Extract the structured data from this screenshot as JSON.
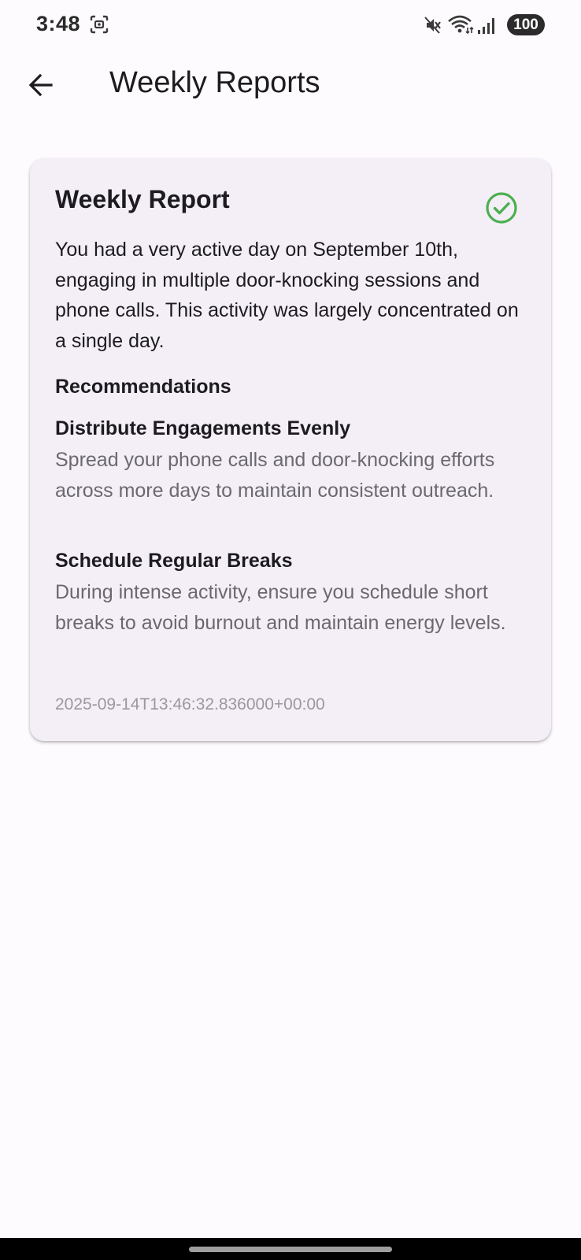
{
  "status_bar": {
    "time": "3:48",
    "battery": "100",
    "icons": [
      "screenshot-icon",
      "mute-icon",
      "wifi-icon",
      "signal-icon"
    ]
  },
  "app_bar": {
    "title": "Weekly Reports",
    "back_icon": "arrow-left-icon"
  },
  "report": {
    "title": "Weekly Report",
    "status_icon": "check-circle-icon",
    "status_color": "#4caf50",
    "summary": "You had a very active day on September 10th, engaging in multiple door-knocking sessions and phone calls. This activity was largely concentrated on a single day.",
    "recommendations_heading": "Recommendations",
    "recommendations": [
      {
        "title": "Distribute Engagements Evenly",
        "description": "Spread your phone calls and door-knocking efforts across more days to maintain consistent outreach."
      },
      {
        "title": "Schedule Regular Breaks",
        "description": "During intense activity, ensure you schedule short breaks to avoid burnout and maintain energy levels."
      }
    ],
    "timestamp": "2025-09-14T13:46:32.836000+00:00"
  },
  "colors": {
    "background": "#fefbff",
    "card": "#f4eff7",
    "text_primary": "#1d1b20",
    "text_secondary": "#6b6870",
    "text_muted": "#9a979e"
  }
}
